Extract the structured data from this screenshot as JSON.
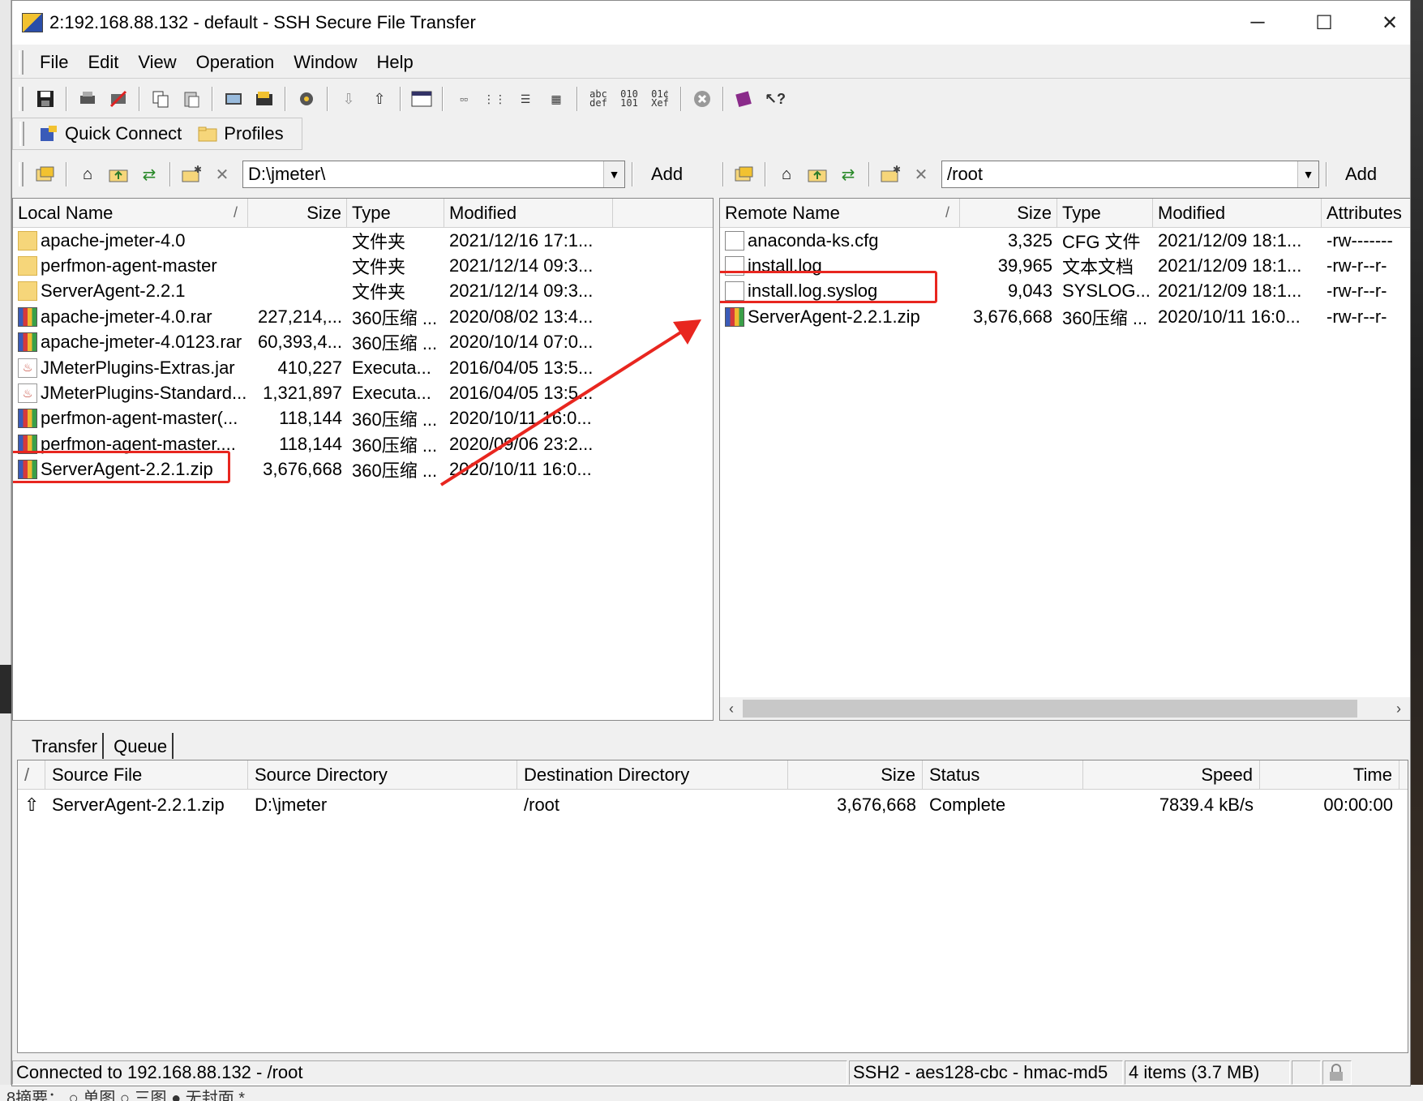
{
  "window": {
    "title": "2:192.168.88.132 - default - SSH Secure File Transfer",
    "minimize": "─",
    "maximize": "☐",
    "close": "✕"
  },
  "menu": [
    {
      "label": "File"
    },
    {
      "label": "Edit"
    },
    {
      "label": "View"
    },
    {
      "label": "Operation"
    },
    {
      "label": "Window"
    },
    {
      "label": "Help"
    }
  ],
  "quick": {
    "connect_label": "Quick Connect",
    "profiles_label": "Profiles"
  },
  "local": {
    "path": "D:\\jmeter\\",
    "add_label": "Add",
    "headers": {
      "name": "Local Name",
      "size": "Size",
      "type": "Type",
      "modified": "Modified"
    },
    "sort_mark": "/",
    "files": [
      {
        "name": "apache-jmeter-4.0",
        "size": "",
        "type": "文件夹",
        "modified": "2021/12/16 17:1...",
        "icon": "folder-icon"
      },
      {
        "name": "perfmon-agent-master",
        "size": "",
        "type": "文件夹",
        "modified": "2021/12/14 09:3...",
        "icon": "folder-icon"
      },
      {
        "name": "ServerAgent-2.2.1",
        "size": "",
        "type": "文件夹",
        "modified": "2021/12/14 09:3...",
        "icon": "folder-icon"
      },
      {
        "name": "apache-jmeter-4.0.rar",
        "size": "227,214,...",
        "type": "360压缩 ...",
        "modified": "2020/08/02 13:4...",
        "icon": "archive-icon"
      },
      {
        "name": "apache-jmeter-4.0123.rar",
        "size": "60,393,4...",
        "type": "360压缩 ...",
        "modified": "2020/10/14 07:0...",
        "icon": "archive-icon"
      },
      {
        "name": "JMeterPlugins-Extras.jar",
        "size": "410,227",
        "type": "Executa...",
        "modified": "2016/04/05 13:5...",
        "icon": "java-jar-icon"
      },
      {
        "name": "JMeterPlugins-Standard...",
        "size": "1,321,897",
        "type": "Executa...",
        "modified": "2016/04/05 13:5...",
        "icon": "java-jar-icon"
      },
      {
        "name": "perfmon-agent-master(...",
        "size": "118,144",
        "type": "360压缩 ...",
        "modified": "2020/10/11 16:0...",
        "icon": "archive-icon"
      },
      {
        "name": "perfmon-agent-master....",
        "size": "118,144",
        "type": "360压缩 ...",
        "modified": "2020/09/06 23:2...",
        "icon": "archive-icon"
      },
      {
        "name": "ServerAgent-2.2.1.zip",
        "size": "3,676,668",
        "type": "360压缩 ...",
        "modified": "2020/10/11 16:0...",
        "icon": "archive-icon"
      }
    ]
  },
  "remote": {
    "path": "/root",
    "add_label": "Add",
    "headers": {
      "name": "Remote Name",
      "size": "Size",
      "type": "Type",
      "modified": "Modified",
      "attributes": "Attributes"
    },
    "sort_mark": "/",
    "files": [
      {
        "name": "anaconda-ks.cfg",
        "size": "3,325",
        "type": "CFG 文件",
        "modified": "2021/12/09 18:1...",
        "attr": "-rw-------",
        "icon": "file-icon"
      },
      {
        "name": "install.log",
        "size": "39,965",
        "type": "文本文档",
        "modified": "2021/12/09 18:1...",
        "attr": "-rw-r--r-",
        "icon": "file-icon"
      },
      {
        "name": "install.log.syslog",
        "size": "9,043",
        "type": "SYSLOG...",
        "modified": "2021/12/09 18:1...",
        "attr": "-rw-r--r-",
        "icon": "file-icon"
      },
      {
        "name": "ServerAgent-2.2.1.zip",
        "size": "3,676,668",
        "type": "360压缩 ...",
        "modified": "2020/10/11 16:0...",
        "attr": "-rw-r--r-",
        "icon": "archive-icon"
      }
    ]
  },
  "transfer": {
    "tabs": [
      {
        "label": "Transfer"
      },
      {
        "label": "Queue"
      }
    ],
    "headers": {
      "sort": "/",
      "source_file": "Source File",
      "source_dir": "Source Directory",
      "dest_dir": "Destination Directory",
      "size": "Size",
      "status": "Status",
      "speed": "Speed",
      "time": "Time"
    },
    "rows": [
      {
        "direction": "⇧",
        "source_file": "ServerAgent-2.2.1.zip",
        "source_dir": "D:\\jmeter",
        "dest_dir": "/root",
        "size": "3,676,668",
        "status": "Complete",
        "speed": "7839.4 kB/s",
        "time": "00:00:00"
      }
    ]
  },
  "status": {
    "connection": "Connected to 192.168.88.132 - /root",
    "cipher": "SSH2 - aes128-cbc - hmac-md5",
    "items": "4 items (3.7 MB)"
  },
  "background": {
    "bottom_text": "8摘要：      ○ 单图      ○ 三图      ● 无封面    *"
  },
  "colors": {
    "highlight": "#e8261f",
    "window_bg": "#f0f0f0"
  }
}
